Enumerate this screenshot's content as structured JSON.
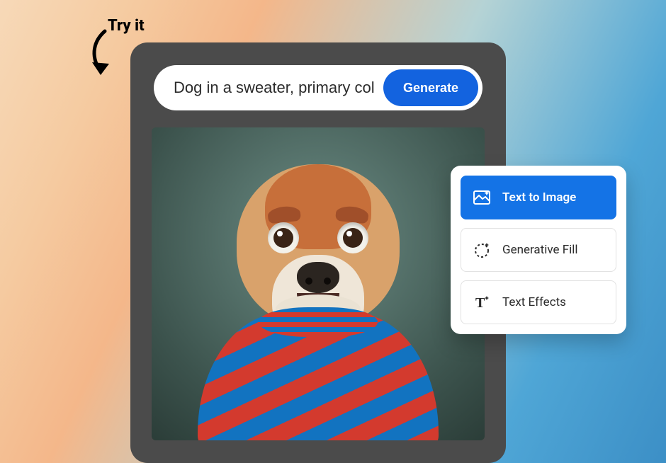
{
  "tryit_label": "Try it",
  "prompt": {
    "value": "Dog in a sweater, primary col…",
    "generate_label": "Generate"
  },
  "options": {
    "items": [
      {
        "label": "Text to Image",
        "active": true
      },
      {
        "label": "Generative Fill",
        "active": false
      },
      {
        "label": "Text Effects",
        "active": false
      }
    ]
  },
  "colors": {
    "accent": "#1473e6"
  }
}
